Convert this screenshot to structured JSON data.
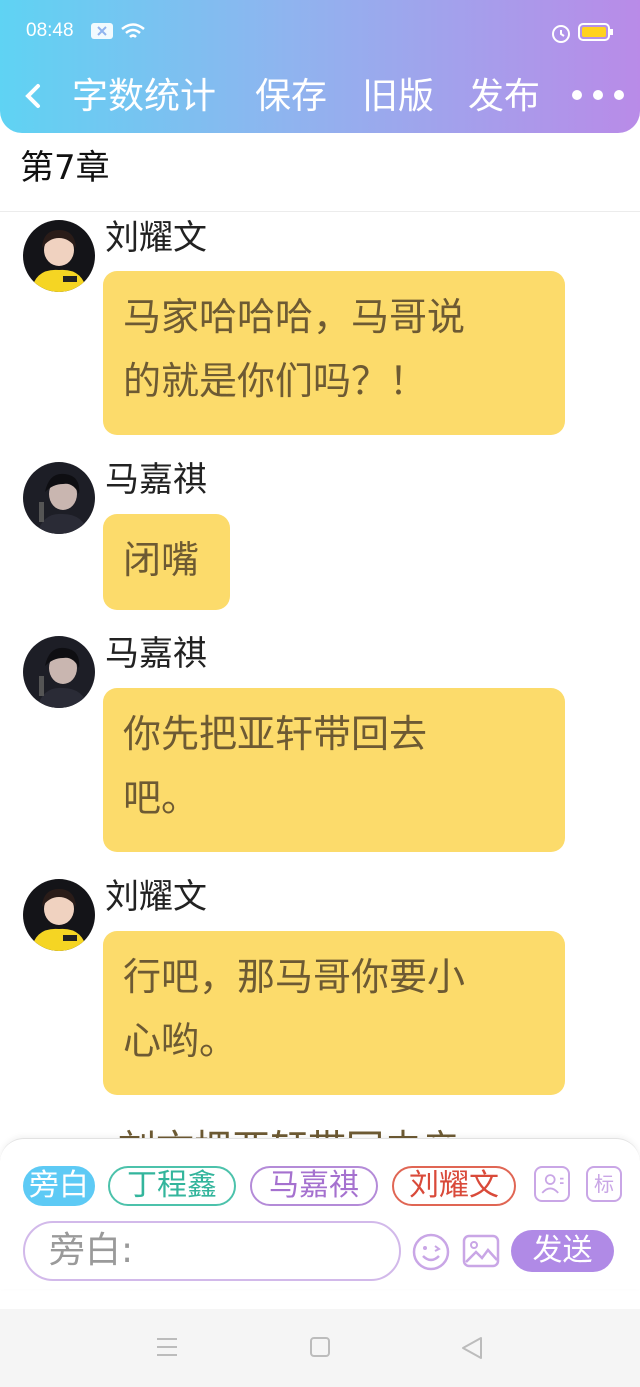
{
  "status_bar": {
    "time": "08:48"
  },
  "header": {
    "nav_items": [
      "字数统计",
      "保存",
      "旧版",
      "发布"
    ]
  },
  "chapter": {
    "title": "第7章"
  },
  "messages": [
    {
      "sender": "刘耀文",
      "text_lines": [
        "马家哈哈哈，马哥说",
        "的就是你们吗？！"
      ]
    },
    {
      "sender": "马嘉祺",
      "text_lines": [
        "闭嘴"
      ]
    },
    {
      "sender": "马嘉祺",
      "text_lines": [
        "你先把亚轩带回去",
        "吧。"
      ]
    },
    {
      "sender": "刘耀文",
      "text_lines": [
        "行吧，那马哥你要小",
        "心哟。"
      ]
    }
  ],
  "peek_text": "刘文把亚轩带回去亲",
  "composer": {
    "role_chips": [
      "旁白",
      "丁程鑫",
      "马嘉祺",
      "刘耀文"
    ],
    "tag_icon_label": "标",
    "input_placeholder": "旁白:",
    "send_label": "发送"
  },
  "colors": {
    "bubble": "#fcdb6b",
    "bubble_text": "#6d5a33",
    "header_gradient_start": "#5fd3f3",
    "header_gradient_end": "#b98be8",
    "send_button": "#b08ae6"
  }
}
